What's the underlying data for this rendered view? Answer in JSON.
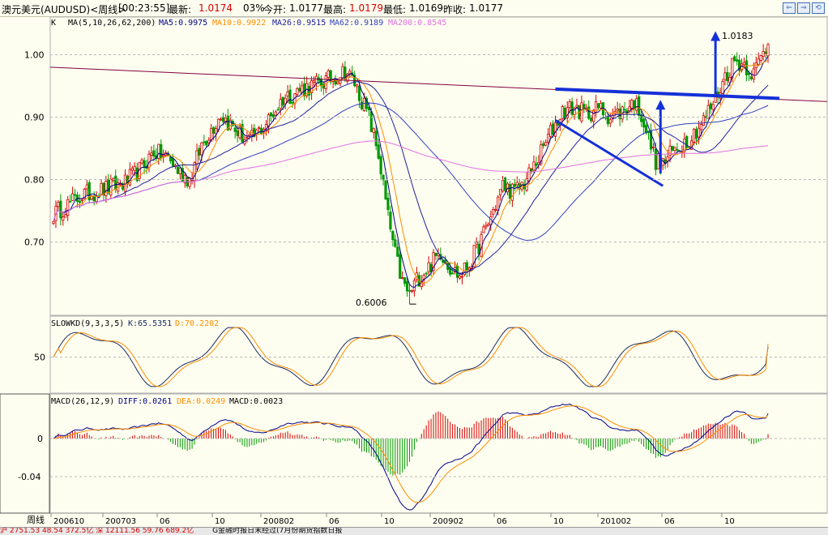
{
  "header": {
    "title": "澳元美元(AUDUSD)<周线>",
    "time": "[00:23:55]",
    "latest_label": "最新:",
    "latest": "1.0174",
    "change": "03%",
    "open_label": "今开:",
    "open": "1.0177",
    "high_label": "最高:",
    "high": "1.0179",
    "low_label": "最低:",
    "low": "1.0169",
    "prev_label": "昨收:",
    "prev": "1.0177"
  },
  "legends": {
    "main_k": "K",
    "ma_params": "MA(5,10,26,62,200)",
    "ma5": "MA5:0.9975",
    "ma10": "MA10:0.9922",
    "ma26": "MA26:0.9515",
    "ma62": "MA62:0.9189",
    "ma200": "MA200:0.8545",
    "kd_title": "SLOWKD(9,3,3,5)",
    "kd_k": "K:65.5351",
    "kd_d": "D:70.2202",
    "macd_title": "MACD(26,12,9)",
    "macd_diff": "DIFF:0.0261",
    "macd_dea": "DEA:0.0249",
    "macd_val": "MACD:0.0023"
  },
  "annotations": {
    "low": "0.6006",
    "high": "1.0183"
  },
  "colors": {
    "up": "#d40000",
    "down": "#009900",
    "ma5": "#00008b",
    "ma10": "#ff8c00",
    "ma26": "#2020a0",
    "ma62": "#3040c0",
    "ma200": "#e070e0",
    "kd_k": "#1a2a60",
    "kd_d": "#ff8c00",
    "drawing": "#1530d8",
    "trendline": "#800040"
  },
  "chart_data": [
    {
      "type": "candlestick",
      "name": "price",
      "x_ticks": [
        "200610",
        "200703",
        "06",
        "10",
        "200802",
        "06",
        "10",
        "200902",
        "06",
        "10",
        "201002",
        "06",
        "10"
      ],
      "ylim": [
        0.58,
        1.05
      ],
      "y_ticks": [
        1.0,
        0.9,
        0.8,
        0.7
      ],
      "grid": true,
      "path": [
        [
          0,
          0.745
        ],
        [
          12,
          0.775
        ],
        [
          22,
          0.785
        ],
        [
          30,
          0.795
        ],
        [
          36,
          0.815
        ],
        [
          42,
          0.845
        ],
        [
          48,
          0.835
        ],
        [
          52,
          0.815
        ],
        [
          57,
          0.8
        ],
        [
          62,
          0.855
        ],
        [
          70,
          0.905
        ],
        [
          76,
          0.88
        ],
        [
          82,
          0.86
        ],
        [
          90,
          0.895
        ],
        [
          96,
          0.93
        ],
        [
          104,
          0.945
        ],
        [
          112,
          0.955
        ],
        [
          118,
          0.965
        ],
        [
          122,
          0.975
        ],
        [
          126,
          0.955
        ],
        [
          132,
          0.9
        ],
        [
          136,
          0.84
        ],
        [
          140,
          0.74
        ],
        [
          143,
          0.68
        ],
        [
          146,
          0.635
        ],
        [
          149,
          0.615
        ],
        [
          152,
          0.64
        ],
        [
          157,
          0.66
        ],
        [
          162,
          0.685
        ],
        [
          166,
          0.66
        ],
        [
          170,
          0.645
        ],
        [
          174,
          0.665
        ],
        [
          178,
          0.695
        ],
        [
          183,
          0.74
        ],
        [
          188,
          0.79
        ],
        [
          193,
          0.78
        ],
        [
          198,
          0.8
        ],
        [
          203,
          0.835
        ],
        [
          208,
          0.875
        ],
        [
          213,
          0.91
        ],
        [
          218,
          0.915
        ],
        [
          223,
          0.905
        ],
        [
          228,
          0.915
        ],
        [
          233,
          0.9
        ],
        [
          238,
          0.91
        ],
        [
          243,
          0.925
        ],
        [
          246,
          0.905
        ],
        [
          249,
          0.865
        ],
        [
          252,
          0.83
        ],
        [
          255,
          0.825
        ],
        [
          258,
          0.84
        ],
        [
          262,
          0.855
        ],
        [
          267,
          0.87
        ],
        [
          272,
          0.895
        ],
        [
          277,
          0.93
        ],
        [
          281,
          0.965
        ],
        [
          285,
          0.99
        ],
        [
          289,
          0.985
        ],
        [
          293,
          0.97
        ],
        [
          296,
          0.995
        ],
        [
          299,
          1.0183
        ]
      ],
      "annotated_low": 0.6006,
      "annotated_high": 1.0183,
      "ma5_last": 0.9975,
      "ma10_last": 0.9922,
      "ma26_last": 0.9515,
      "ma62_last": 0.9189,
      "ma200_last": 0.8545
    },
    {
      "type": "line",
      "name": "slowkd",
      "y_ticks": [
        50
      ],
      "ylim": [
        0,
        100
      ],
      "series": [
        {
          "name": "K",
          "last": 65.5351
        },
        {
          "name": "D",
          "last": 70.2202
        }
      ]
    },
    {
      "type": "bar",
      "name": "macd",
      "y_ticks": [
        0,
        -0.04
      ],
      "ylim": [
        -0.075,
        0.035
      ],
      "series": [
        {
          "name": "DIFF",
          "last": 0.0261
        },
        {
          "name": "DEA",
          "last": 0.0249
        },
        {
          "name": "MACD",
          "last": 0.0023
        }
      ]
    }
  ],
  "status": {
    "label": "周线",
    "ticker": "沪 2751.53  48.54  372.5亿  深 12111.56  59.76  689.2亿",
    "news": "G金融时报日末经过(7月份期货指数日报"
  }
}
